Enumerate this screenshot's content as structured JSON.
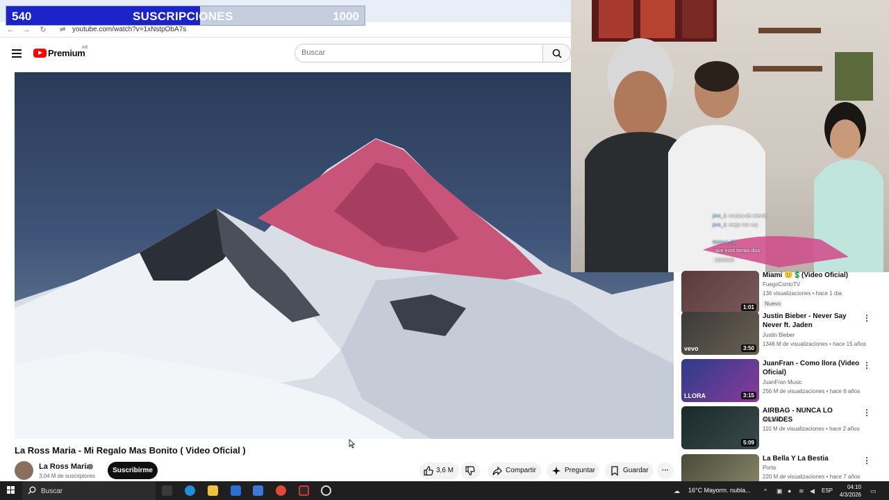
{
  "browser": {
    "url": "youtube.com/watch?v=1xNstpObA7s",
    "tab_plus": "+",
    "back": "←",
    "forward": "→",
    "reload": "↻"
  },
  "overlay": {
    "current": "540",
    "label": "SUSCRIPCIONES",
    "goal": "1000",
    "progress": 0.54
  },
  "header": {
    "brand": "Premium",
    "region": "AR",
    "search_placeholder": "Buscar"
  },
  "video": {
    "title": "La Ross Maria - Mi Regalo Mas Bonito ( Video Oficial )",
    "channel": "La Ross Maria",
    "subscribers": "3,04 M de suscriptores",
    "subscribe_label": "Suscribirme",
    "likes": "3,6 M",
    "share_label": "Compartir",
    "ask_label": "Preguntar",
    "save_label": "Guardar"
  },
  "chat": [
    {
      "user": "jere_1",
      "text": ": musica de mierda"
    },
    {
      "user": "jere_1",
      "text": ": mejor me voy"
    },
    {
      "user": "",
      "text": ""
    },
    {
      "user": "Melanii_09",
      "text": ":"
    },
    {
      "user": "",
      "text": ": que esos temas dios"
    },
    {
      "user": "",
      "text": ": jajajajaja"
    }
  ],
  "recommendations": [
    {
      "title": "Miami 🙂💲(Video Oficial)",
      "channel": "FuegoContoTV",
      "meta": "136 visualizaciones • hace 1 día",
      "badge": "Nuevo",
      "duration": "1:01",
      "colors": [
        "#5a3a3a",
        "#7a5a5a"
      ]
    },
    {
      "title": "Justin Bieber - Never Say Never ft. Jaden",
      "channel": "Justin Bieber",
      "meta": "1346 M de visualizaciones • hace 15 años",
      "badge": "",
      "duration": "3:50",
      "thumb_text": "vevo",
      "colors": [
        "#3a3a3a",
        "#6a6050"
      ]
    },
    {
      "title": "JuanFran - Como llora (Video Oficial)",
      "channel": "JuanFran Music",
      "meta": "256 M de visualizaciones • hace 6 años",
      "badge": "",
      "duration": "3:15",
      "thumb_text": "LLORA",
      "colors": [
        "#2a3d8a",
        "#8a3a9a"
      ]
    },
    {
      "title": "AIRBAG - NUNCA LO OLVIDES",
      "channel": "AIRBAG",
      "meta": "110 M de visualizaciones • hace 2 años",
      "badge": "",
      "duration": "5:09",
      "colors": [
        "#1a2a2a",
        "#3a4a4a"
      ]
    },
    {
      "title": "La Bella Y La Bestia",
      "channel": "Porta",
      "meta": "220 M de visualizaciones • hace 7 años",
      "badge": "",
      "duration": "",
      "colors": [
        "#4a4a3a",
        "#8a8a6a"
      ]
    }
  ],
  "taskbar": {
    "search_label": "Buscar",
    "weather": "16°C  Mayorm. nubla...",
    "lang": "ESP",
    "time": "04:10",
    "date": "4/3/2026"
  }
}
